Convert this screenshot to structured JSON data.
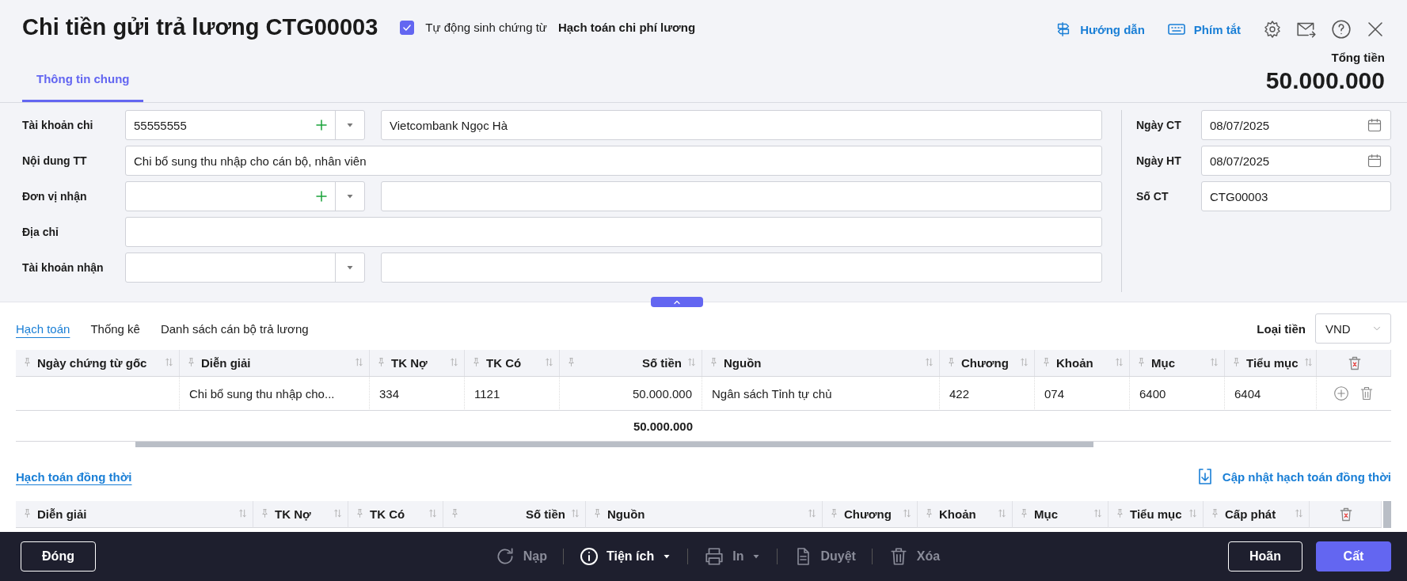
{
  "window": {
    "title": "Chi tiền gửi trả lương CTG00003"
  },
  "auto_generate": {
    "checked": true,
    "label": "Tự động sinh chứng từ",
    "value": "Hạch toán chi phí lương"
  },
  "header_links": [
    {
      "kind": "guide",
      "label": "Hướng dẫn"
    },
    {
      "kind": "keyboard",
      "label": "Phím tắt"
    }
  ],
  "total": {
    "label": "Tổng tiền",
    "value": "50.000.000"
  },
  "tabs": [
    {
      "label": "Thông tin chung",
      "selected": true
    }
  ],
  "form_left": [
    {
      "kind": "combo",
      "label": "Tài khoản chi",
      "value": "55555555",
      "add": true,
      "detail": "Vietcombank Ngọc Hà"
    },
    {
      "kind": "text",
      "label": "Nội dung TT",
      "value": "Chi bổ sung thu nhập cho cán bộ, nhân viên"
    },
    {
      "kind": "combo",
      "label": "Đơn vị nhận",
      "add": true
    },
    {
      "kind": "text",
      "label": "Địa chỉ"
    },
    {
      "kind": "combo",
      "label": "Tài khoản nhận",
      "add": false
    }
  ],
  "form_right": [
    {
      "kind": "date",
      "label": "Ngày CT",
      "value": "08/07/2025"
    },
    {
      "kind": "date",
      "label": "Ngày HT",
      "value": "08/07/2025"
    },
    {
      "kind": "text",
      "label": "Số CT",
      "value": "CTG00003"
    }
  ],
  "detail_tabs": [
    {
      "label": "Hạch toán",
      "selected": true
    },
    {
      "label": "Thống kê",
      "selected": false
    },
    {
      "label": "Danh sách cán bộ trả lương",
      "selected": false
    }
  ],
  "currency": {
    "label": "Loại tiền",
    "value": "VND"
  },
  "grid": {
    "columns": [
      "Ngày chứng từ gốc",
      "Diễn giải",
      "TK Nợ",
      "TK Có",
      "Số tiền",
      "Nguồn",
      "Chương",
      "Khoản",
      "Mục",
      "Tiểu mục"
    ],
    "rows": [
      {
        "cells": [
          "",
          "Chi bổ sung thu nhập cho...",
          "334",
          "1121",
          "50.000.000",
          "Ngân sách Tỉnh tự chủ",
          "422",
          "074",
          "6400",
          "6404"
        ]
      }
    ],
    "total": "50.000.000"
  },
  "sync_section": {
    "title": "Hạch toán đồng thời",
    "action": "Cập nhật hạch toán đồng thời"
  },
  "grid2": {
    "columns": [
      "Diễn giải",
      "TK Nợ",
      "TK Có",
      "Số tiền",
      "Nguồn",
      "Chương",
      "Khoản",
      "Mục",
      "Tiểu mục",
      "Cấp phát"
    ]
  },
  "footer": {
    "close": "Đóng",
    "actions": [
      {
        "kind": "refresh",
        "label": "Nạp",
        "disabled": true,
        "dropdown": false
      },
      {
        "kind": "info",
        "label": "Tiện ích",
        "disabled": false,
        "dropdown": true
      },
      {
        "kind": "print",
        "label": "In",
        "disabled": true,
        "dropdown": true
      },
      {
        "kind": "document",
        "label": "Duyệt",
        "disabled": true,
        "dropdown": false
      },
      {
        "kind": "trash",
        "label": "Xóa",
        "disabled": true,
        "dropdown": false
      }
    ],
    "buttons": [
      {
        "kind": "outline",
        "label": "Hoãn"
      },
      {
        "kind": "primary",
        "label": "Cất"
      }
    ]
  }
}
